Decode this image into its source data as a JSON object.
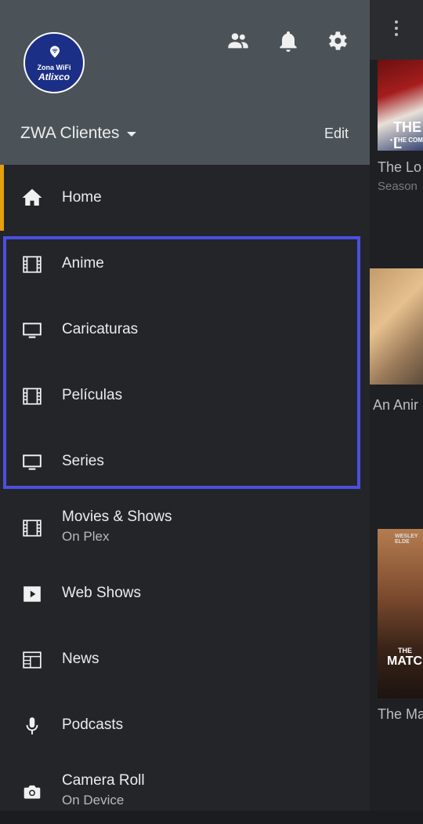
{
  "app": {
    "background_titles": [
      "The Lo",
      "An Anir",
      "The Ma"
    ],
    "background_subtitle": "Season",
    "poster_texts": [
      "THE L",
      "• THE COMP",
      "WESLEY ELDE",
      "THE",
      "MATCH"
    ]
  },
  "header": {
    "logo_line1": "Zona WiFi",
    "logo_line2": "Atlixco",
    "account_name": "ZWA Clientes",
    "edit_label": "Edit",
    "icons": [
      "people-icon",
      "bell-icon",
      "gear-icon"
    ]
  },
  "nav": {
    "home": "Home",
    "anime": "Anime",
    "caricaturas": "Caricaturas",
    "peliculas": "Películas",
    "series": "Series",
    "movies_shows": "Movies & Shows",
    "movies_shows_sub": "On Plex",
    "web_shows": "Web Shows",
    "news": "News",
    "podcasts": "Podcasts",
    "camera_roll": "Camera Roll",
    "camera_roll_sub": "On Device"
  },
  "colors": {
    "accent": "#e5a00d",
    "highlight": "#4b4fe0",
    "header_bg": "#4b5358",
    "drawer_bg": "#242529"
  }
}
